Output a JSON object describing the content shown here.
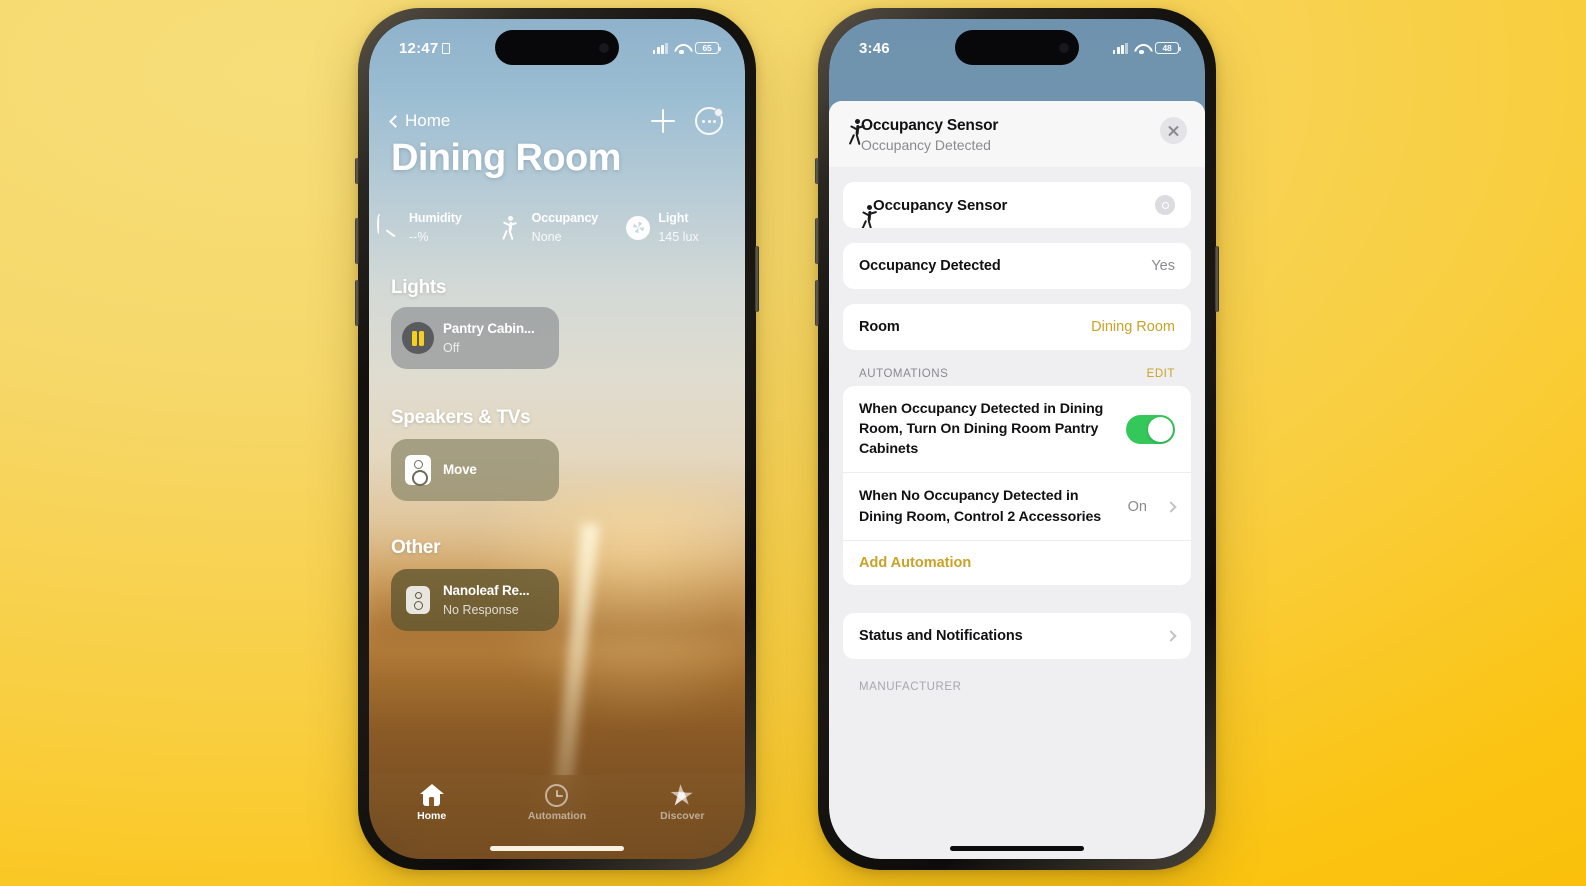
{
  "background": {
    "color_top_left": "#F7DE7A",
    "color_bottom_right": "#FAC00A"
  },
  "left_phone": {
    "status_bar": {
      "time": "12:47",
      "battery": "65",
      "location_icon": "location-icon",
      "cellular_icon": "cellular-bars-icon",
      "wifi_icon": "wifi-icon"
    },
    "nav": {
      "back_label": "Home",
      "add_icon": "plus-icon",
      "more_icon": "ellipsis-circle-icon"
    },
    "title": "Dining Room",
    "sensors": [
      {
        "icon": "humidity-gauge-icon",
        "name": "Humidity",
        "value": "--%"
      },
      {
        "icon": "occupancy-walker-icon",
        "name": "Occupancy",
        "value": "None"
      },
      {
        "icon": "light-sun-icon",
        "name": "Light",
        "value": "145 lux"
      }
    ],
    "sections": [
      {
        "heading": "Lights",
        "tiles": [
          {
            "icon": "light-bars-icon",
            "name": "Pantry Cabin...",
            "state": "Off"
          }
        ]
      },
      {
        "heading": "Speakers & TVs",
        "tiles": [
          {
            "icon": "speaker-icon",
            "name": "Move",
            "state": ""
          }
        ]
      },
      {
        "heading": "Other",
        "tiles": [
          {
            "icon": "nanoleaf-icon",
            "name": "Nanoleaf Re...",
            "state": "No Response"
          }
        ]
      }
    ],
    "tabs": [
      {
        "label": "Home",
        "icon": "home-icon",
        "active": true
      },
      {
        "label": "Automation",
        "icon": "clock-icon",
        "active": false
      },
      {
        "label": "Discover",
        "icon": "star-icon",
        "active": false
      }
    ]
  },
  "right_phone": {
    "status_bar": {
      "time": "3:46",
      "battery": "48",
      "cellular_icon": "cellular-bars-icon",
      "wifi_icon": "wifi-icon"
    },
    "sheet_header": {
      "icon": "occupancy-walker-icon",
      "title": "Occupancy Sensor",
      "subtitle": "Occupancy Detected",
      "close_icon": "close-icon"
    },
    "device_card": {
      "icon": "occupancy-walker-icon",
      "name": "Occupancy Sensor",
      "power_icon": "power-icon"
    },
    "detail_rows": [
      {
        "label": "Occupancy Detected",
        "value": "Yes",
        "accent": false
      },
      {
        "label": "Room",
        "value": "Dining Room",
        "accent": true
      }
    ],
    "automations": {
      "group_title": "AUTOMATIONS",
      "edit_label": "EDIT",
      "items": [
        {
          "text": "When Occupancy Detected in Dining Room, Turn On Dining Room Pantry Cabinets",
          "control": "toggle",
          "toggle_on": true,
          "state": ""
        },
        {
          "text": "When No Occupancy Detected in Dining Room, Control 2 Accessories",
          "control": "disclosure",
          "toggle_on": false,
          "state": "On"
        }
      ],
      "add_label": "Add Automation"
    },
    "status_row": {
      "label": "Status and Notifications",
      "chevron_icon": "chevron-right-icon"
    },
    "manufacturer_heading": "MANUFACTURER"
  },
  "colors": {
    "accent_gold": "#C9A227",
    "toggle_green": "#34C759",
    "bulb_yellow": "#F5D020",
    "sheet_bg": "#EFEFF2"
  }
}
